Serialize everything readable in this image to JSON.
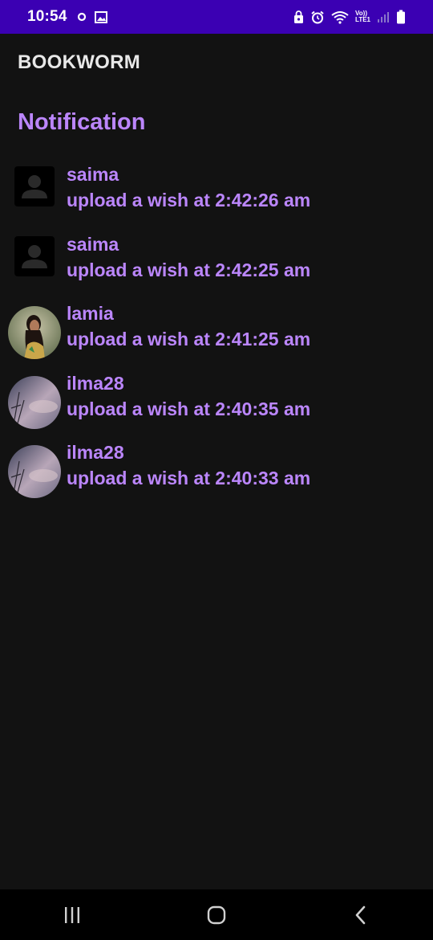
{
  "status_bar": {
    "time": "10:54",
    "left_icons": [
      "circle-notification-icon",
      "image-icon"
    ],
    "right_icons": [
      "lock-icon",
      "alarm-icon",
      "wifi-icon",
      "volte-icon",
      "signal-icon",
      "battery-icon"
    ],
    "volte_label_top": "Vo))",
    "volte_label_bottom": "LTE1",
    "background": "#3b00b3"
  },
  "app": {
    "title": "BOOKWORM",
    "section_title": "Notification",
    "accent": "#bb86fc"
  },
  "notifications": [
    {
      "user": "saima",
      "message": "upload a wish at 2:42:26 am",
      "avatar": "placeholder-person-icon"
    },
    {
      "user": "saima",
      "message": "upload a wish at 2:42:25 am",
      "avatar": "placeholder-person-icon"
    },
    {
      "user": "lamia",
      "message": "upload a wish at 2:41:25 am",
      "avatar": "photo-avatar"
    },
    {
      "user": "ilma28",
      "message": "upload a wish at 2:40:35 am",
      "avatar": "sky-photo-avatar"
    },
    {
      "user": "ilma28",
      "message": "upload a wish at 2:40:33 am",
      "avatar": "sky-photo-avatar"
    }
  ],
  "nav_bar": {
    "buttons": [
      "recent-apps-icon",
      "home-icon",
      "back-icon"
    ]
  }
}
